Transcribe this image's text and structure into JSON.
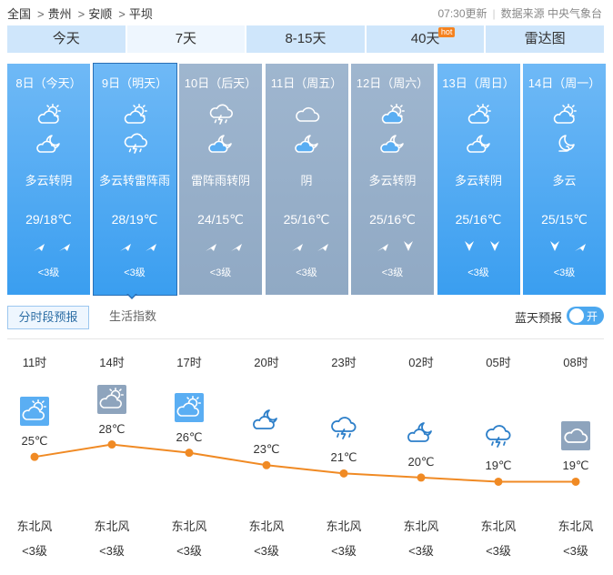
{
  "breadcrumb": [
    "全国",
    "贵州",
    "安顺",
    "平坝"
  ],
  "update_time": "07:30更新",
  "data_source": "数据来源 中央气象台",
  "tabs": [
    {
      "label": "今天",
      "active": false
    },
    {
      "label": "7天",
      "active": true
    },
    {
      "label": "8-15天",
      "active": false
    },
    {
      "label": "40天",
      "active": false,
      "badge": "hot"
    },
    {
      "label": "雷达图",
      "active": false
    }
  ],
  "days": [
    {
      "date": "8日（今天）",
      "icon_day": "partly-cloudy-icon",
      "icon_night": "cloudy-night-icon",
      "desc": "多云转阴",
      "temp": "29/18℃",
      "wind_dirs": [
        "northeast-arrow",
        "northeast-arrow"
      ],
      "wind_level": "<3级",
      "style": "sunny"
    },
    {
      "date": "9日（明天）",
      "icon_day": "partly-cloudy-icon",
      "icon_night": "thunder-rain-icon",
      "desc": "多云转雷阵雨",
      "temp": "28/19℃",
      "wind_dirs": [
        "northeast-arrow",
        "northeast-arrow"
      ],
      "wind_level": "<3级",
      "style": "sunny",
      "selected": true
    },
    {
      "date": "10日（后天）",
      "icon_day": "thunder-rain-icon",
      "icon_night": "cloudy-night-icon",
      "desc": "雷阵雨转阴",
      "temp": "24/15℃",
      "wind_dirs": [
        "northeast-arrow",
        "northeast-arrow"
      ],
      "wind_level": "<3级",
      "style": "gray"
    },
    {
      "date": "11日（周五）",
      "icon_day": "cloud-icon",
      "icon_night": "cloudy-night-icon",
      "desc": "阴",
      "temp": "25/16℃",
      "wind_dirs": [
        "northeast-arrow",
        "northeast-arrow"
      ],
      "wind_level": "<3级",
      "style": "gray"
    },
    {
      "date": "12日（周六）",
      "icon_day": "partly-cloudy-icon",
      "icon_night": "cloudy-night-icon",
      "desc": "多云转阴",
      "temp": "25/16℃",
      "wind_dirs": [
        "northeast-arrow",
        "north-arrow"
      ],
      "wind_level": "<3级",
      "style": "gray"
    },
    {
      "date": "13日（周日）",
      "icon_day": "partly-cloudy-icon",
      "icon_night": "cloudy-night-icon",
      "desc": "多云转阴",
      "temp": "25/16℃",
      "wind_dirs": [
        "north-arrow",
        "north-arrow"
      ],
      "wind_level": "<3级",
      "style": "sunny"
    },
    {
      "date": "14日（周一）",
      "icon_day": "partly-cloudy-icon",
      "icon_night": "moon-cloud-icon",
      "desc": "多云",
      "temp": "25/15℃",
      "wind_dirs": [
        "north-arrow",
        "northeast-arrow"
      ],
      "wind_level": "<3级",
      "style": "sunny"
    }
  ],
  "sub_tabs": {
    "active": "分时段预报",
    "other": "生活指数"
  },
  "blue_sky": {
    "label": "蓝天预报",
    "toggle": "开"
  },
  "hourly": [
    {
      "time": "11时",
      "temp": 25,
      "temp_label": "25℃",
      "icon": "partly-cloudy-icon",
      "wind": "东北风",
      "level": "<3级"
    },
    {
      "time": "14时",
      "temp": 28,
      "temp_label": "28℃",
      "icon": "partly-cloudy-icon",
      "wind": "东北风",
      "level": "<3级"
    },
    {
      "time": "17时",
      "temp": 26,
      "temp_label": "26℃",
      "icon": "partly-cloudy-icon",
      "wind": "东北风",
      "level": "<3级"
    },
    {
      "time": "20时",
      "temp": 23,
      "temp_label": "23℃",
      "icon": "cloudy-night-icon",
      "wind": "东北风",
      "level": "<3级"
    },
    {
      "time": "23时",
      "temp": 21,
      "temp_label": "21℃",
      "icon": "thunder-rain-icon",
      "wind": "东北风",
      "level": "<3级"
    },
    {
      "time": "02时",
      "temp": 20,
      "temp_label": "20℃",
      "icon": "cloudy-night-icon",
      "wind": "东北风",
      "level": "<3级"
    },
    {
      "time": "05时",
      "temp": 19,
      "temp_label": "19℃",
      "icon": "thunder-rain-icon",
      "wind": "东北风",
      "level": "<3级"
    },
    {
      "time": "08时",
      "temp": 19,
      "temp_label": "19℃",
      "icon": "cloud-icon",
      "wind": "东北风",
      "level": "<3级"
    }
  ],
  "colors": {
    "accent": "#4ca8ef",
    "curve": "#f08a24",
    "card_sunny": "#3a9ef0",
    "card_gray": "#90a9c4"
  }
}
